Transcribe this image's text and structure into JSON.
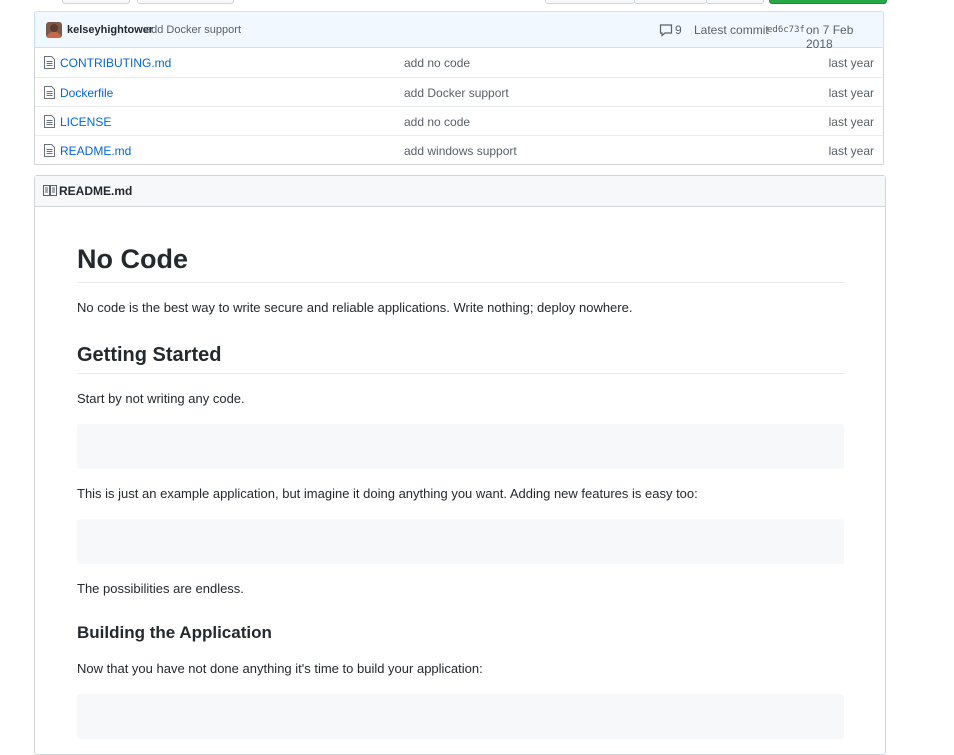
{
  "commit": {
    "author": "kelseyhightower",
    "message": "add Docker support",
    "comments": "9",
    "latest_label": "Latest commit",
    "sha": "ed6c73f",
    "date": "on 7 Feb 2018"
  },
  "files": [
    {
      "name": "CONTRIBUTING.md",
      "message": "add no code",
      "age": "last year"
    },
    {
      "name": "Dockerfile",
      "message": "add Docker support",
      "age": "last year"
    },
    {
      "name": "LICENSE",
      "message": "add no code",
      "age": "last year"
    },
    {
      "name": "README.md",
      "message": "add windows support",
      "age": "last year"
    }
  ],
  "readme": {
    "filename": "README.md",
    "h1": "No Code",
    "intro": "No code is the best way to write secure and reliable applications. Write nothing; deploy nowhere.",
    "getting_started": "Getting Started",
    "start_text": "Start by not writing any code.",
    "example_text": "This is just an example application, but imagine it doing anything you want. Adding new features is easy too:",
    "endless_text": "The possibilities are endless.",
    "building_heading": "Building the Application",
    "building_text": "Now that you have not done anything it's time to build your application:"
  },
  "colors": {
    "link": "#0366d6",
    "commit_bar_bg": "#f1f8ff",
    "code_bg": "#f6f8fa",
    "green_button": "#28a745"
  },
  "icons": {
    "commit_comments": "comment-icon",
    "file": "file-icon",
    "readme": "book-icon"
  }
}
